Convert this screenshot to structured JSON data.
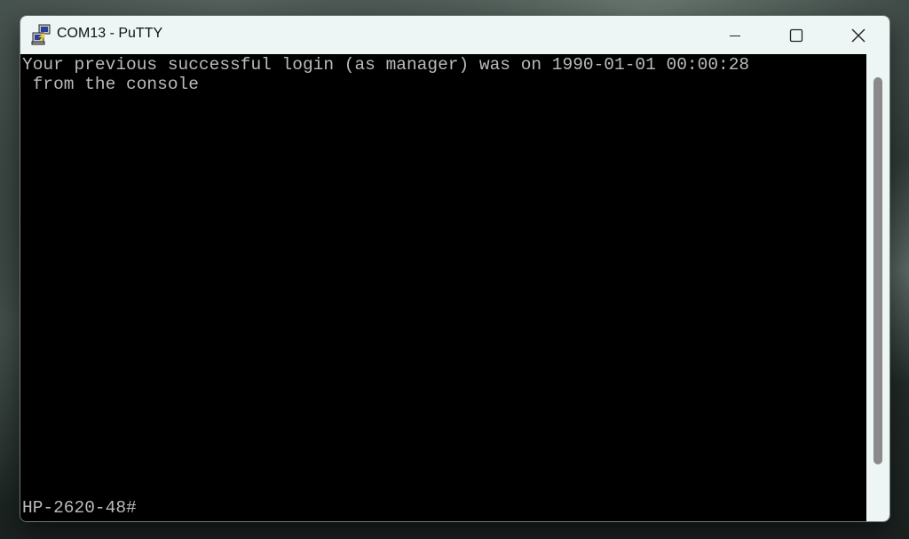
{
  "window": {
    "title": "COM13 - PuTTY",
    "icon": "putty-icon",
    "controls": {
      "minimize": "minimize-icon",
      "maximize": "maximize-icon",
      "close": "close-icon"
    }
  },
  "terminal": {
    "lines": [
      "Your previous successful login (as manager) was on 1990-01-01 00:00:28",
      " from the console"
    ],
    "prompt": "HP-2620-48#"
  },
  "colors": {
    "titlebar_bg": "#eef6f5",
    "terminal_bg": "#000000",
    "terminal_fg": "#bbbbbb",
    "scroll_thumb": "#8a8a8a"
  }
}
